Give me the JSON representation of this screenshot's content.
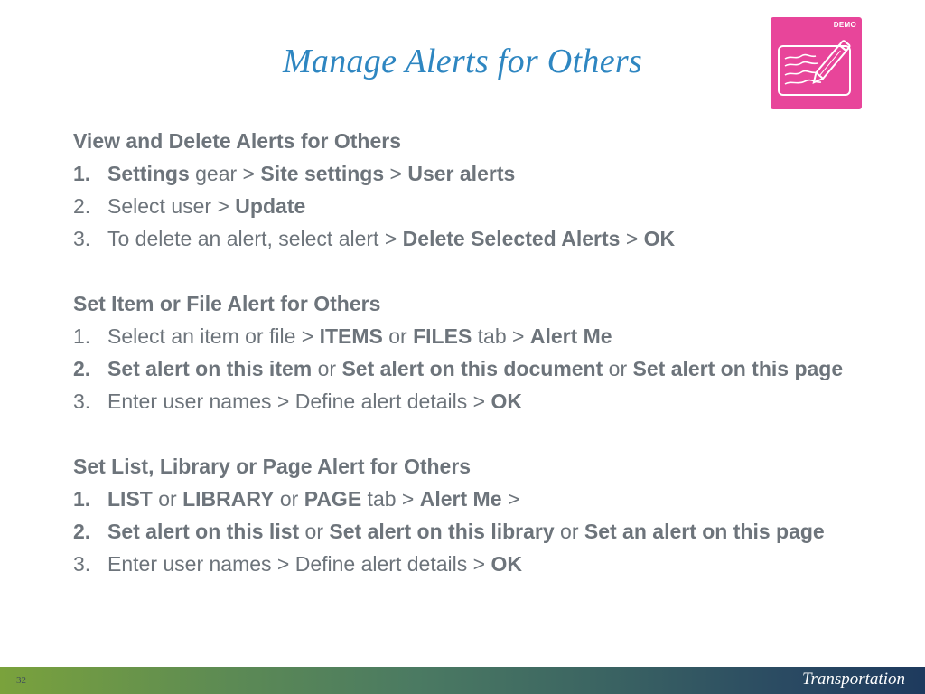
{
  "slide": {
    "title": "Manage Alerts for Others",
    "badge_label": "DEMO",
    "badge_icon": "pencil-writing-icon",
    "badge_color": "#e8459a",
    "title_color": "#2e86c1",
    "text_color": "#6d747b"
  },
  "sections": [
    {
      "heading": "View and Delete Alerts for Others",
      "steps": [
        {
          "num": "1.",
          "num_bold": true,
          "parts": [
            {
              "t": "Settings",
              "b": true
            },
            {
              "t": " gear > ",
              "b": false
            },
            {
              "t": "Site settings",
              "b": true
            },
            {
              "t": " > ",
              "b": false
            },
            {
              "t": "User alerts",
              "b": true
            }
          ]
        },
        {
          "num": "2.",
          "num_bold": false,
          "parts": [
            {
              "t": "Select user > ",
              "b": false
            },
            {
              "t": "Update",
              "b": true
            }
          ]
        },
        {
          "num": "3.",
          "num_bold": false,
          "parts": [
            {
              "t": "To delete an alert, select alert > ",
              "b": false
            },
            {
              "t": "Delete Selected Alerts",
              "b": true
            },
            {
              "t": " > ",
              "b": false
            },
            {
              "t": "OK",
              "b": true
            }
          ]
        }
      ]
    },
    {
      "heading": "Set Item or File Alert for Others",
      "steps": [
        {
          "num": "1.",
          "num_bold": false,
          "parts": [
            {
              "t": "Select an item or file > ",
              "b": false
            },
            {
              "t": "ITEMS",
              "b": true
            },
            {
              "t": " or ",
              "b": false
            },
            {
              "t": "FILES",
              "b": true
            },
            {
              "t": " tab > ",
              "b": false
            },
            {
              "t": "Alert Me",
              "b": true
            }
          ]
        },
        {
          "num": "2.",
          "num_bold": true,
          "parts": [
            {
              "t": "Set alert on this item",
              "b": true
            },
            {
              "t": " or ",
              "b": false
            },
            {
              "t": "Set alert on this document",
              "b": true
            },
            {
              "t": " or ",
              "b": false
            },
            {
              "t": "Set alert on this page",
              "b": true
            }
          ]
        },
        {
          "num": "3.",
          "num_bold": false,
          "parts": [
            {
              "t": "Enter user names > Define alert details > ",
              "b": false
            },
            {
              "t": "OK",
              "b": true
            }
          ]
        }
      ]
    },
    {
      "heading": "Set List, Library or Page Alert for Others",
      "steps": [
        {
          "num": "1.",
          "num_bold": true,
          "parts": [
            {
              "t": "LIST",
              "b": true
            },
            {
              "t": " or ",
              "b": false
            },
            {
              "t": "LIBRARY",
              "b": true
            },
            {
              "t": " or ",
              "b": false
            },
            {
              "t": "PAGE",
              "b": true
            },
            {
              "t": " tab > ",
              "b": false
            },
            {
              "t": "Alert Me",
              "b": true
            },
            {
              "t": " >",
              "b": false
            }
          ]
        },
        {
          "num": "2.",
          "num_bold": true,
          "parts": [
            {
              "t": "Set alert on this list",
              "b": true
            },
            {
              "t": " or ",
              "b": false
            },
            {
              "t": "Set alert on this library",
              "b": true
            },
            {
              "t": " or ",
              "b": false
            },
            {
              "t": "Set an alert on this page",
              "b": true
            }
          ]
        },
        {
          "num": "3.",
          "num_bold": false,
          "parts": [
            {
              "t": "Enter user names > Define alert details > ",
              "b": false
            },
            {
              "t": "OK",
              "b": true
            }
          ]
        }
      ]
    }
  ],
  "footer": {
    "page_number": "32",
    "brand": "Transportation"
  }
}
